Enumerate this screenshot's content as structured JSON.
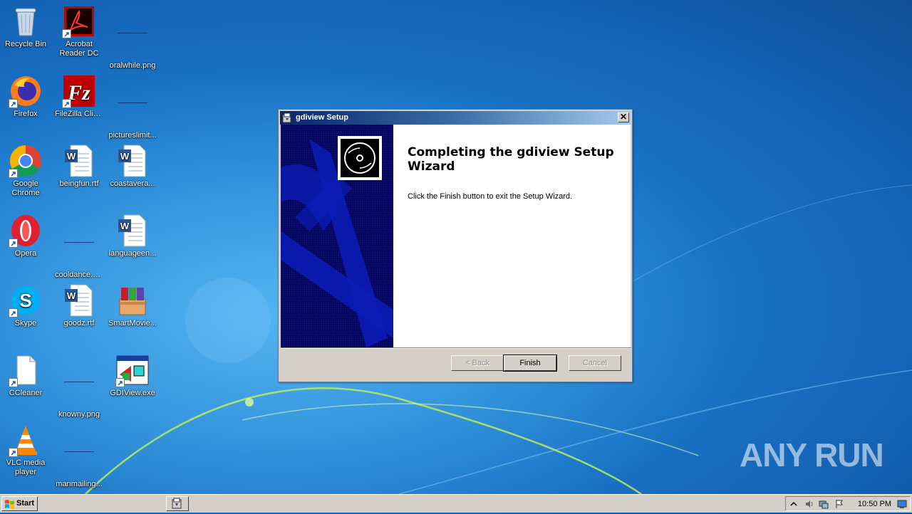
{
  "desktop_icons": [
    {
      "label": "Recycle Bin",
      "icon": "recycle-bin-icon"
    },
    {
      "label": "Acrobat Reader DC",
      "icon": "acrobat-icon"
    },
    {
      "label": "oralwhile.png",
      "icon": "png-file-icon"
    },
    {
      "label": "Firefox",
      "icon": "firefox-icon"
    },
    {
      "label": "FileZilla Client",
      "icon": "filezilla-icon"
    },
    {
      "label": "pictureslimit...",
      "icon": "png-file-icon"
    },
    {
      "label": "Google Chrome",
      "icon": "chrome-icon"
    },
    {
      "label": "beingfun.rtf",
      "icon": "word-doc-icon"
    },
    {
      "label": "coastavera...",
      "icon": "word-doc-icon"
    },
    {
      "label": "Opera",
      "icon": "opera-icon"
    },
    {
      "label": "cooldance.png",
      "icon": "png-file-icon"
    },
    {
      "label": "languageen...",
      "icon": "word-doc-icon"
    },
    {
      "label": "Skype",
      "icon": "skype-icon"
    },
    {
      "label": "goodz.rtf",
      "icon": "word-doc-icon"
    },
    {
      "label": "SmartMovie...",
      "icon": "winrar-icon"
    },
    {
      "label": "CCleaner",
      "icon": "ccleaner-icon"
    },
    {
      "label": "knowny.png",
      "icon": "png-file-icon"
    },
    {
      "label": "GDIView.exe",
      "icon": "gdiview-icon"
    },
    {
      "label": "VLC media player",
      "icon": "vlc-icon"
    },
    {
      "label": "manmailing...",
      "icon": "png-file-icon"
    }
  ],
  "dialog": {
    "title": "gdiview Setup",
    "heading": "Completing the gdiview Setup Wizard",
    "body": "Click the Finish button to exit the Setup Wizard.",
    "buttons": {
      "back": "< Back",
      "finish": "Finish",
      "cancel": "Cancel"
    },
    "close_label": "✕"
  },
  "taskbar": {
    "start_label": "Start",
    "clock": "10:50 PM"
  },
  "watermark": "ANY RUN"
}
